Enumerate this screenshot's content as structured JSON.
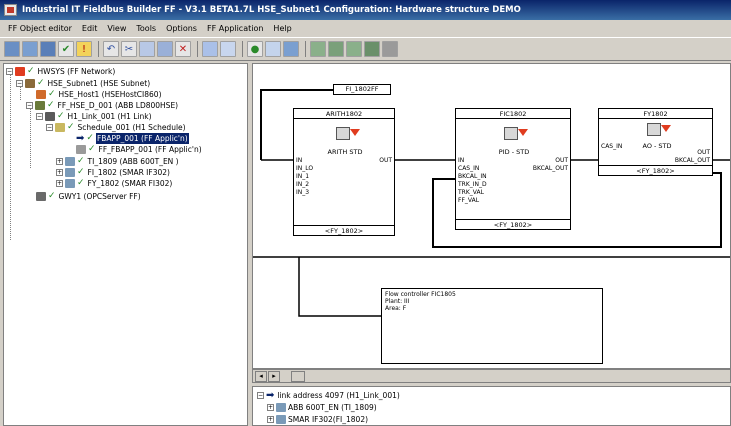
{
  "window": {
    "title": "Industrial IT Fieldbus Builder FF - V3.1 BETA1.7L HSE_Subnet1 Configuration: Hardware structure DEMO"
  },
  "menu": [
    "FF Object editor",
    "Edit",
    "View",
    "Tools",
    "Options",
    "FF Application",
    "Help"
  ],
  "toolbar": {
    "icons": [
      "grid-icon",
      "grid2-icon",
      "save-icon",
      "check-icon",
      "warning-icon",
      "undo-icon",
      "cut-icon",
      "copy-icon",
      "paste-icon",
      "delete-icon",
      "table-icon",
      "image-icon",
      "refresh-icon",
      "tools-icon",
      "settings-icon",
      "download-icon",
      "upload-icon",
      "export-icon",
      "import-icon",
      "tile-icon"
    ]
  },
  "tree": {
    "items": [
      {
        "label": "HWSYS (FF Network)",
        "selected": false
      },
      {
        "label": "HSE_Subnet1 (HSE Subnet)",
        "selected": false
      },
      {
        "label": "HSE_Host1 (HSEHostCI860)",
        "selected": false
      },
      {
        "label": "FF_HSE_D_001 (ABB LD800HSE)",
        "selected": false
      },
      {
        "label": "H1_Link_001 (H1 Link)",
        "selected": false
      },
      {
        "label": "Schedule_001 (H1 Schedule)",
        "selected": false
      },
      {
        "label": "FBAPP_001 (FF Applic'n)",
        "selected": true
      },
      {
        "label": "FF_FBAPP_001 (FF Applic'n)",
        "selected": false
      },
      {
        "label": "TI_1809 (ABB 600T_EN )",
        "selected": false
      },
      {
        "label": "FI_1802 (SMAR IF302)",
        "selected": false
      },
      {
        "label": "FY_1802 (SMAR FI302)",
        "selected": false
      },
      {
        "label": "GWY1 (OPCServer FF)",
        "selected": false
      }
    ]
  },
  "diagram": {
    "tag_input": "FI_1802FF",
    "blocks": [
      {
        "title": "ARITH1802",
        "type": "ARITH STD",
        "footer": "<FY_1802>",
        "inputs": [
          "IN",
          "IN_LO",
          "IN_1",
          "IN_2",
          "IN_3"
        ],
        "outputs": [
          "OUT"
        ]
      },
      {
        "title": "FIC1802",
        "type": "PID - STD",
        "footer": "<FY_1802>",
        "inputs": [
          "IN",
          "CAS_IN",
          "BKCAL_IN",
          "TRK_IN_D",
          "TRK_VAL",
          "FF_VAL"
        ],
        "outputs": [
          "OUT",
          "BKCAL_OUT"
        ]
      },
      {
        "title": "FY1802",
        "type": "AO - STD",
        "footer": "<FY_1802>",
        "inputs": [
          "CAS_IN"
        ],
        "outputs": [
          "OUT",
          "BKCAL_OUT"
        ]
      }
    ],
    "note": {
      "lines": [
        "Flow controller FIC1805",
        "Plant: III",
        "Area: F"
      ]
    }
  },
  "bottom": {
    "items": [
      {
        "label": "link address 4097 (H1_Link_001)"
      },
      {
        "label": "ABB 600T_EN (TI_1809)"
      },
      {
        "label": "SMAR IF302(FI_1802)"
      }
    ]
  }
}
